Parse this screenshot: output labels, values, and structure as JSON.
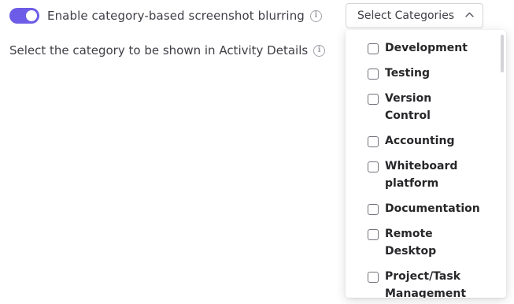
{
  "settings": {
    "blur_toggle": {
      "enabled": true,
      "accent": "#6c5ce7"
    },
    "blur_label": "Enable category-based screenshot blurring",
    "activity_label": "Select the category to be shown in Activity Details"
  },
  "select": {
    "label": "Select Categories",
    "expanded": true
  },
  "icons": {
    "info": "i",
    "chevron": "chevron-up-icon"
  },
  "options": [
    {
      "label": "Development",
      "checked": false
    },
    {
      "label": "Testing",
      "checked": false
    },
    {
      "label": "Version Control",
      "checked": false
    },
    {
      "label": "Accounting",
      "checked": false
    },
    {
      "label": "Whiteboard platform",
      "checked": false
    },
    {
      "label": "Documentation",
      "checked": false
    },
    {
      "label": "Remote Desktop",
      "checked": false
    },
    {
      "label": "Project/Task Management",
      "checked": false
    }
  ]
}
